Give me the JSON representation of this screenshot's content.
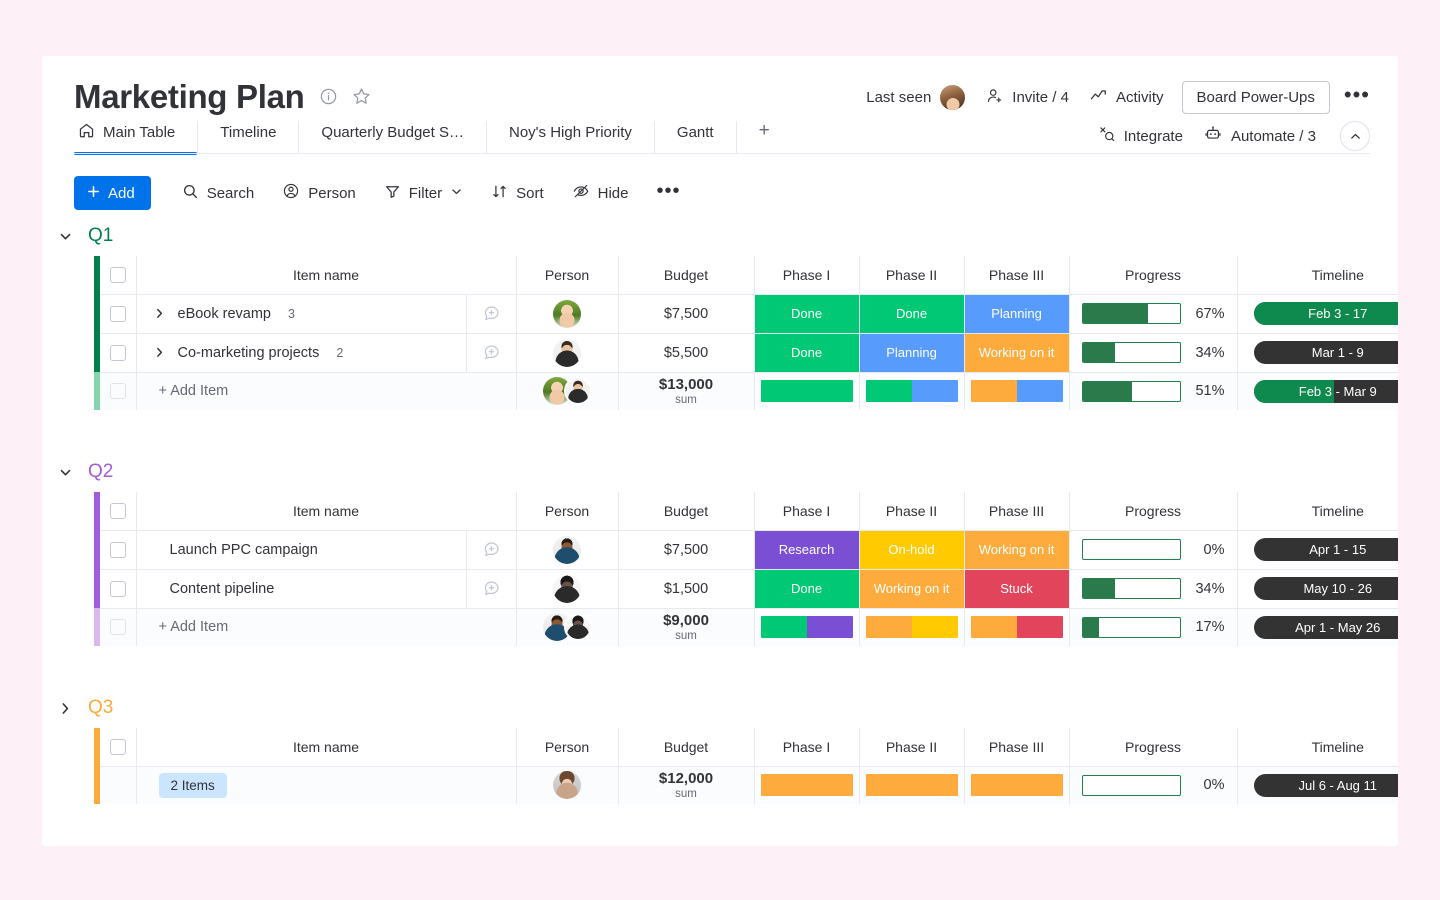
{
  "page": {
    "background_color": "#fdf0f7",
    "card_background": "#ffffff"
  },
  "header": {
    "title": "Marketing Plan",
    "info_icon": "info-icon",
    "star_icon": "star-icon",
    "last_seen_label": "Last seen",
    "invite_label": "Invite / 4",
    "activity_label": "Activity",
    "power_ups_label": "Board Power-Ups",
    "more_label": "•••",
    "integrate_label": "Integrate",
    "automate_label": "Automate / 3"
  },
  "tabs": [
    {
      "label": "Main Table",
      "icon": "home-icon",
      "active": true
    },
    {
      "label": "Timeline",
      "active": false
    },
    {
      "label": "Quarterly Budget S…",
      "active": false
    },
    {
      "label": "Noy's High Priority",
      "active": false
    },
    {
      "label": "Gantt",
      "active": false
    },
    {
      "label": "+",
      "active": false
    }
  ],
  "toolbar": {
    "add_label": "Add",
    "search_label": "Search",
    "person_label": "Person",
    "filter_label": "Filter",
    "sort_label": "Sort",
    "hide_label": "Hide",
    "more_label": "•••"
  },
  "columns": {
    "item_name": "Item name",
    "person": "Person",
    "budget": "Budget",
    "phase1": "Phase I",
    "phase2": "Phase II",
    "phase3": "Phase III",
    "progress": "Progress",
    "timeline": "Timeline"
  },
  "status_colors": {
    "Done": "#00c875",
    "Planning": "#579bfc",
    "Working on it": "#fdab3d",
    "Research": "#a25ddc",
    "On-hold": "#ffcb00",
    "Stuck": "#e2445c"
  },
  "groups": [
    {
      "name": "Q1",
      "color": "#037f4c",
      "color_light": "#86d4ab",
      "expanded": true,
      "collapse_icon": "chevron-down-icon",
      "rows": [
        {
          "name": "eBook revamp",
          "subitem_count": "3",
          "has_chevron": true,
          "budget": "$7,500",
          "phase1": "Done",
          "phase2": "Done",
          "phase3": "Planning",
          "progress_pct": "67%",
          "progress_value": 67,
          "timeline": "Feb 3 - 17",
          "timeline_fill": 88,
          "avatar": "avatar-green"
        },
        {
          "name": "Co-marketing projects",
          "subitem_count": "2",
          "has_chevron": true,
          "budget": "$5,500",
          "phase1": "Done",
          "phase2": "Planning",
          "phase3": "Working on it",
          "progress_pct": "34%",
          "progress_value": 34,
          "timeline": "Mar 1 - 9",
          "timeline_fill": 0,
          "avatar": "avatar-dark"
        }
      ],
      "summary": {
        "add_item_label": "+ Add Item",
        "budget_sum": "$13,000",
        "budget_sum_label": "sum",
        "phase1_segments": [
          {
            "color": "#00c875",
            "pct": 100
          }
        ],
        "phase2_segments": [
          {
            "color": "#00c875",
            "pct": 50
          },
          {
            "color": "#579bfc",
            "pct": 50
          }
        ],
        "phase3_segments": [
          {
            "color": "#fdab3d",
            "pct": 50
          },
          {
            "color": "#579bfc",
            "pct": 50
          }
        ],
        "progress_pct": "51%",
        "progress_value": 51,
        "timeline": "Feb 3 - Mar 9",
        "timeline_fill": 48
      }
    },
    {
      "name": "Q2",
      "color": "#a25ddc",
      "color_light": "#d9b8f0",
      "expanded": true,
      "collapse_icon": "chevron-down-icon",
      "rows": [
        {
          "name": "Launch PPC campaign",
          "subitem_count": "",
          "has_chevron": false,
          "budget": "$7,500",
          "phase1": "Research",
          "phase2": "On-hold",
          "phase3": "Working on it",
          "progress_pct": "0%",
          "progress_value": 0,
          "timeline": "Apr 1 - 15",
          "timeline_fill": 0,
          "avatar": "avatar-blue"
        },
        {
          "name": "Content pipeline",
          "subitem_count": "",
          "has_chevron": false,
          "budget": "$1,500",
          "phase1": "Done",
          "phase2": "Working on it",
          "phase3": "Stuck",
          "progress_pct": "34%",
          "progress_value": 34,
          "timeline": "May 10 - 26",
          "timeline_fill": 0,
          "avatar": "avatar-gray"
        }
      ],
      "summary": {
        "add_item_label": "+ Add Item",
        "budget_sum": "$9,000",
        "budget_sum_label": "sum",
        "phase1_segments": [
          {
            "color": "#00c875",
            "pct": 50
          },
          {
            "color": "#7b4fd4",
            "pct": 50
          }
        ],
        "phase2_segments": [
          {
            "color": "#fdab3d",
            "pct": 50
          },
          {
            "color": "#ffcb00",
            "pct": 50
          }
        ],
        "phase3_segments": [
          {
            "color": "#fdab3d",
            "pct": 50
          },
          {
            "color": "#e2445c",
            "pct": 50
          }
        ],
        "progress_pct": "17%",
        "progress_value": 17,
        "timeline": "Apr 1 - May 26",
        "timeline_fill": 0
      }
    },
    {
      "name": "Q3",
      "color": "#fdab3d",
      "color_light": "#fdd8a3",
      "expanded": false,
      "collapse_icon": "chevron-right-icon",
      "rows": [],
      "summary": {
        "items_badge": "2 Items",
        "budget_sum": "$12,000",
        "budget_sum_label": "sum",
        "phase1_segments": [
          {
            "color": "#fdab3d",
            "pct": 100
          }
        ],
        "phase2_segments": [
          {
            "color": "#fdab3d",
            "pct": 100
          }
        ],
        "phase3_segments": [
          {
            "color": "#fdab3d",
            "pct": 100
          }
        ],
        "progress_pct": "0%",
        "progress_value": 0,
        "timeline": "Jul 6 - Aug 11",
        "timeline_fill": 0,
        "avatar": "avatar-woman"
      }
    }
  ]
}
